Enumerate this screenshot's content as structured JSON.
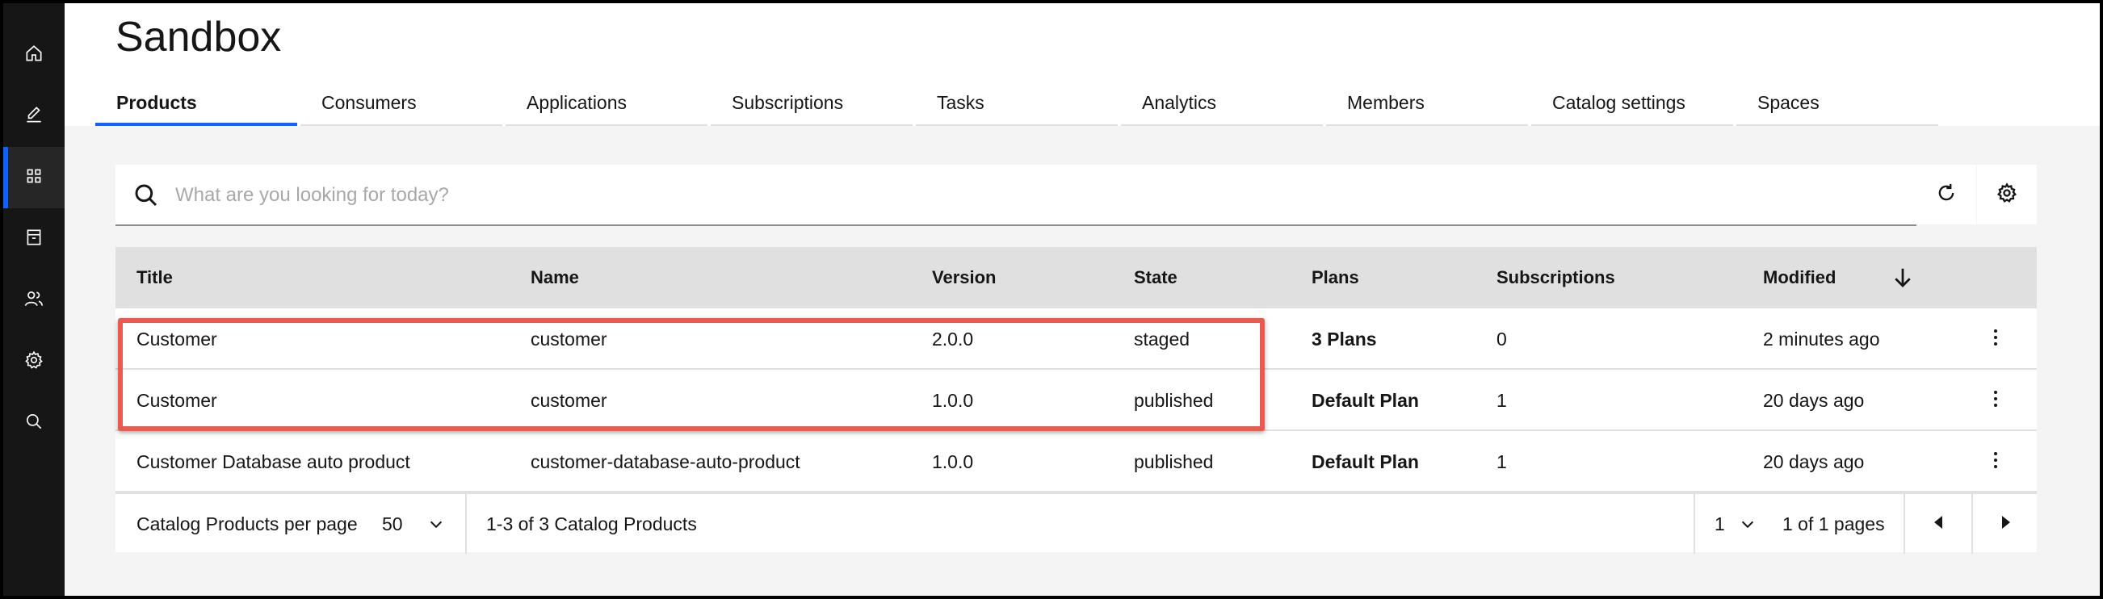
{
  "page": {
    "title": "Sandbox"
  },
  "tabs": [
    {
      "label": "Products"
    },
    {
      "label": "Consumers"
    },
    {
      "label": "Applications"
    },
    {
      "label": "Subscriptions"
    },
    {
      "label": "Tasks"
    },
    {
      "label": "Analytics"
    },
    {
      "label": "Members"
    },
    {
      "label": "Catalog settings"
    },
    {
      "label": "Spaces"
    }
  ],
  "sidebar": {
    "items": [
      {
        "icon": "home-icon"
      },
      {
        "icon": "edit-icon"
      },
      {
        "icon": "grid-icon",
        "active": true
      },
      {
        "icon": "archive-icon"
      },
      {
        "icon": "users-icon"
      },
      {
        "icon": "settings-icon"
      },
      {
        "icon": "search-icon"
      }
    ]
  },
  "search": {
    "placeholder": "What are you looking for today?"
  },
  "table": {
    "headers": [
      "Title",
      "Name",
      "Version",
      "State",
      "Plans",
      "Subscriptions",
      "Modified"
    ],
    "rows": [
      {
        "title": "Customer",
        "name": "customer",
        "version": "2.0.0",
        "state": "staged",
        "plans": "3 Plans",
        "subscriptions": "0",
        "modified": "2 minutes ago"
      },
      {
        "title": "Customer",
        "name": "customer",
        "version": "1.0.0",
        "state": "published",
        "plans": "Default Plan",
        "subscriptions": "1",
        "modified": "20 days ago"
      },
      {
        "title": "Customer Database auto product",
        "name": "customer-database-auto-product",
        "version": "1.0.0",
        "state": "published",
        "plans": "Default Plan",
        "subscriptions": "1",
        "modified": "20 days ago"
      }
    ]
  },
  "pagination": {
    "per_page_label": "Catalog Products per page",
    "per_page_value": "50",
    "range_text": "1-3 of 3 Catalog Products",
    "page_value": "1",
    "pages_text": "1 of 1 pages"
  },
  "colors": {
    "accent": "#0f62fe",
    "highlight": "#ea5a4f",
    "sidebar": "#161616"
  }
}
